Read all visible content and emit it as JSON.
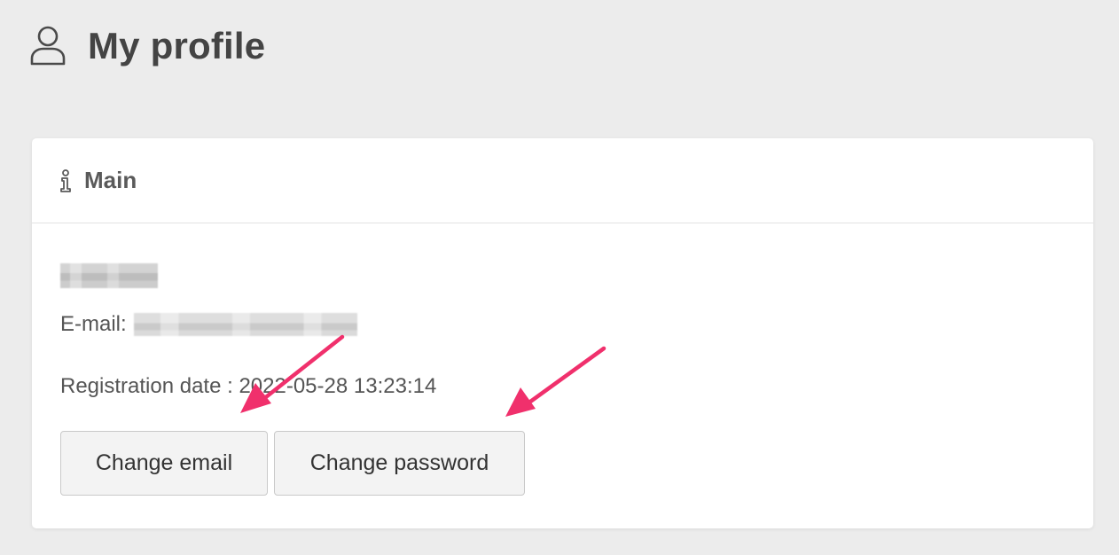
{
  "page": {
    "title": "My profile",
    "icon": "user-icon"
  },
  "card": {
    "title": "Main",
    "icon": "info-icon",
    "email_label": "E-mail:",
    "registration_text": "Registration date : 2022-05-28 13:23:14",
    "buttons": {
      "change_email": "Change email",
      "change_password": "Change password"
    }
  },
  "annotations": {
    "arrow_color": "#f0306c",
    "count": 2
  },
  "colors": {
    "background": "#ececec",
    "card": "#ffffff",
    "text": "#444444",
    "button_bg": "#f3f3f3",
    "button_border": "#c9c9c9"
  }
}
